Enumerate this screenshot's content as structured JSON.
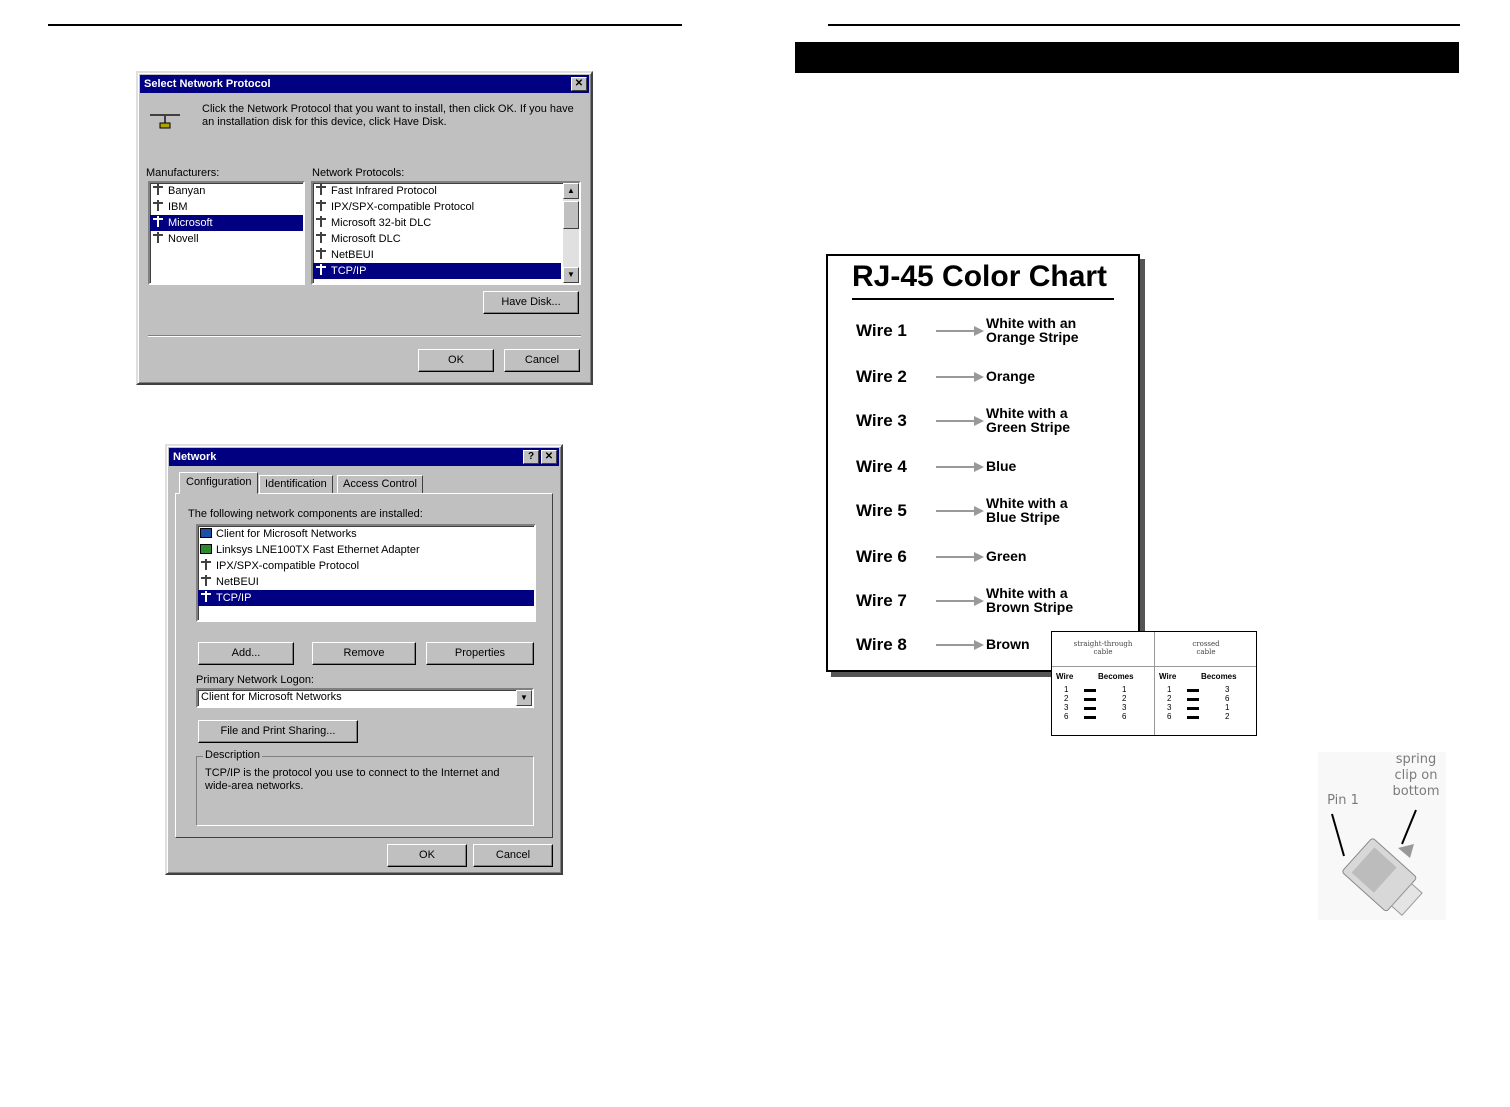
{
  "dialog1": {
    "title": "Select Network Protocol",
    "close_glyph": "✕",
    "instructions": "Click the Network Protocol that you want to install, then click OK. If you have an installation disk for this device, click Have Disk.",
    "manufacturers_label": "Manufacturers:",
    "protocols_label": "Network Protocols:",
    "manufacturers": [
      "Banyan",
      "IBM",
      "Microsoft",
      "Novell"
    ],
    "manufacturers_selected": 2,
    "protocols": [
      "Fast Infrared Protocol",
      "IPX/SPX-compatible Protocol",
      "Microsoft 32-bit DLC",
      "Microsoft DLC",
      "NetBEUI",
      "TCP/IP"
    ],
    "protocols_selected": 5,
    "have_disk": "Have Disk...",
    "ok": "OK",
    "cancel": "Cancel"
  },
  "dialog2": {
    "title": "Network",
    "help_glyph": "?",
    "close_glyph": "✕",
    "tabs": [
      "Configuration",
      "Identification",
      "Access Control"
    ],
    "components_label": "The following network components are installed:",
    "components": [
      {
        "icon": "pc",
        "label": "Client for Microsoft Networks"
      },
      {
        "icon": "card",
        "label": "Linksys LNE100TX Fast Ethernet Adapter"
      },
      {
        "icon": "net",
        "label": "IPX/SPX-compatible Protocol"
      },
      {
        "icon": "net",
        "label": "NetBEUI"
      },
      {
        "icon": "net",
        "label": "TCP/IP"
      }
    ],
    "components_selected": 4,
    "add": "Add...",
    "remove": "Remove",
    "properties": "Properties",
    "logon_label": "Primary Network Logon:",
    "logon_value": "Client for Microsoft Networks",
    "file_print": "File and Print Sharing...",
    "description_label": "Description",
    "description_text": "TCP/IP is the protocol you use to connect to the Internet and wide-area networks.",
    "ok": "OK",
    "cancel": "Cancel"
  },
  "color_chart": {
    "title": "RJ-45 Color Chart",
    "wires": [
      {
        "label": "Wire 1",
        "color": "White with an\nOrange Stripe"
      },
      {
        "label": "Wire 2",
        "color": "Orange"
      },
      {
        "label": "Wire 3",
        "color": "White with a\nGreen Stripe"
      },
      {
        "label": "Wire 4",
        "color": "Blue"
      },
      {
        "label": "Wire 5",
        "color": "White with a\nBlue Stripe"
      },
      {
        "label": "Wire 6",
        "color": "Green"
      },
      {
        "label": "Wire 7",
        "color": "White with a\nBrown Stripe"
      },
      {
        "label": "Wire 8",
        "color": "Brown"
      }
    ]
  },
  "cable_table": {
    "straight": {
      "title": "straight-through\ncable",
      "wire_header": "Wire",
      "becomes_header": "Becomes",
      "wires": [
        "1",
        "2",
        "3",
        "6"
      ],
      "becomes": [
        "1",
        "2",
        "3",
        "6"
      ]
    },
    "crossed": {
      "title": "crossed\ncable",
      "wire_header": "Wire",
      "becomes_header": "Becomes",
      "wires": [
        "1",
        "2",
        "3",
        "6"
      ],
      "becomes": [
        "3",
        "6",
        "1",
        "2"
      ]
    }
  },
  "connector": {
    "pin_label": "Pin 1",
    "clip_label": "spring\nclip on\nbottom"
  }
}
